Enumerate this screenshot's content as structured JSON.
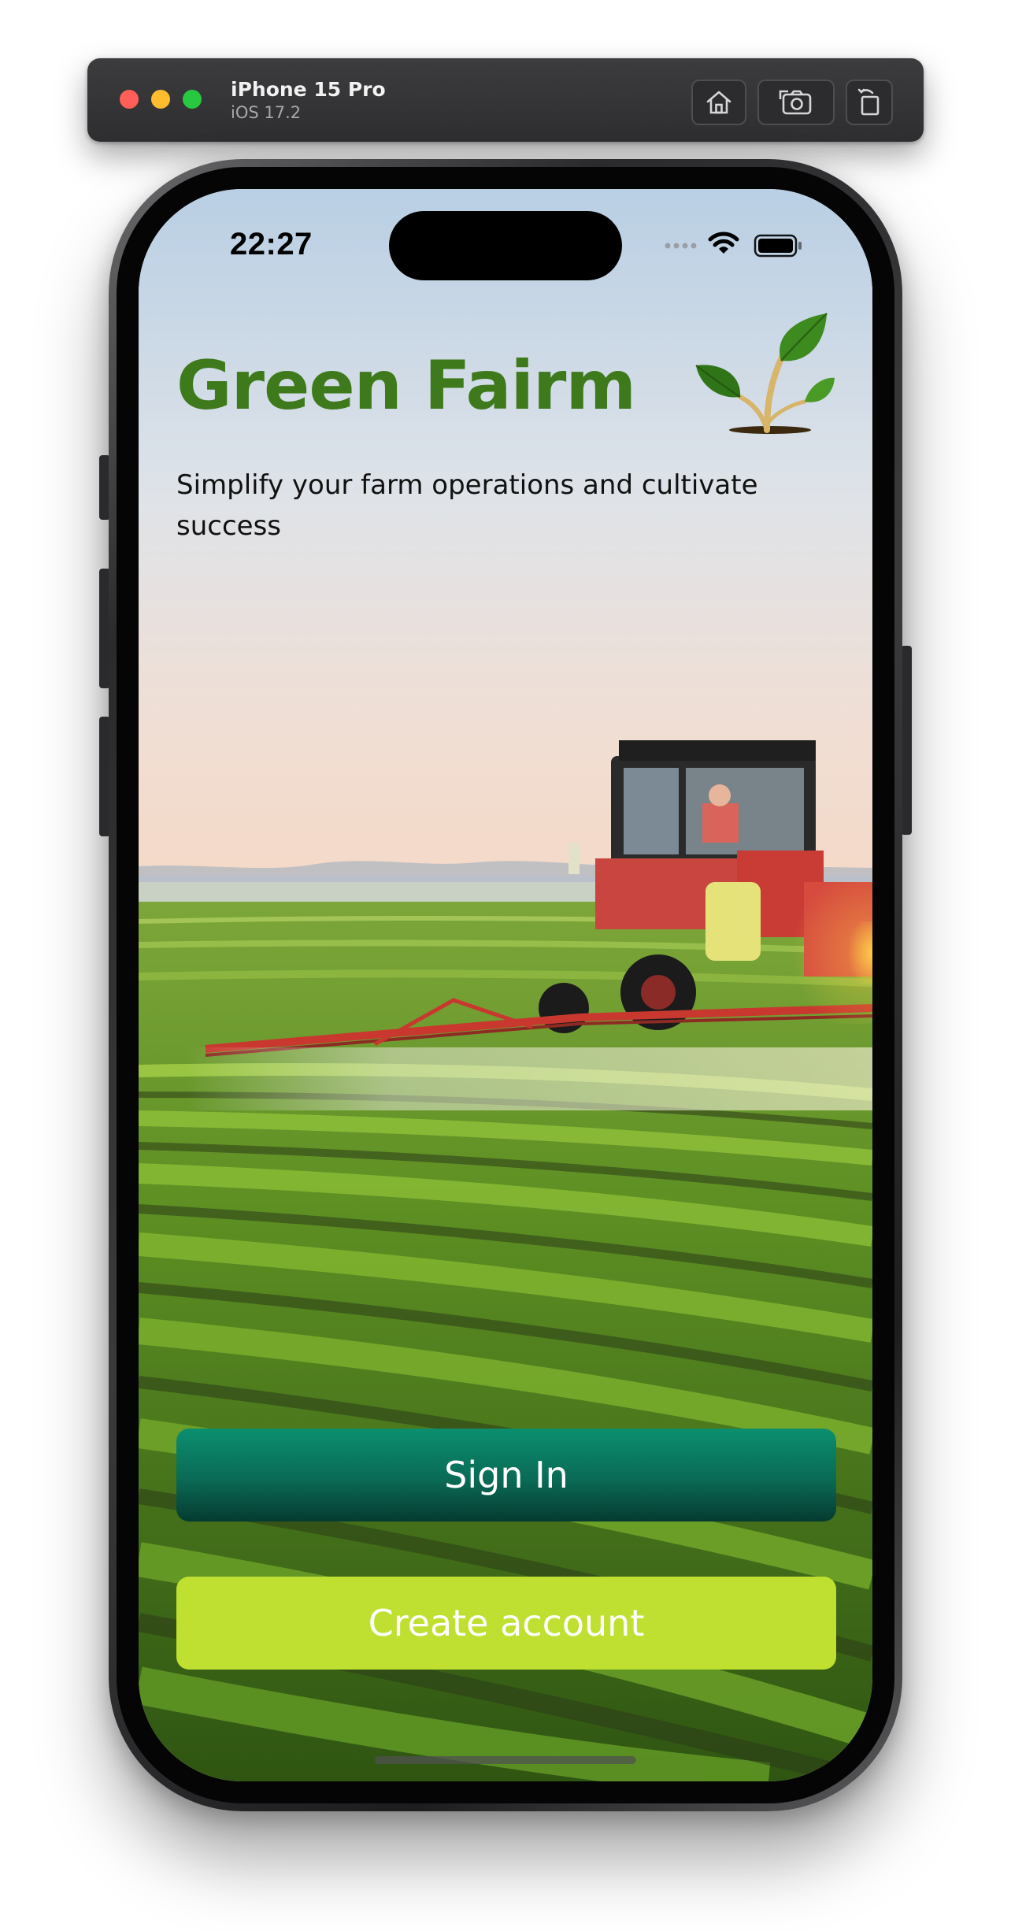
{
  "simulator": {
    "device_name": "iPhone 15 Pro",
    "os_version": "iOS 17.2",
    "toolbar": [
      "home-icon",
      "screenshot-icon",
      "rotate-icon"
    ]
  },
  "status_bar": {
    "time": "22:27",
    "icons": [
      "cellular-dots-icon",
      "wifi-icon",
      "battery-icon"
    ]
  },
  "app": {
    "title": "Green Fairm",
    "tagline": "Simplify your farm operations and cultivate success",
    "logo": "sprout-leaf-icon",
    "background": "tractor-spraying-crop-field-photo"
  },
  "actions": {
    "sign_in_label": "Sign In",
    "create_account_label": "Create account"
  },
  "colors": {
    "title_green": "#3e7a1c",
    "sign_in_button": "#0a6a55",
    "create_account_button": "#bfe030"
  }
}
